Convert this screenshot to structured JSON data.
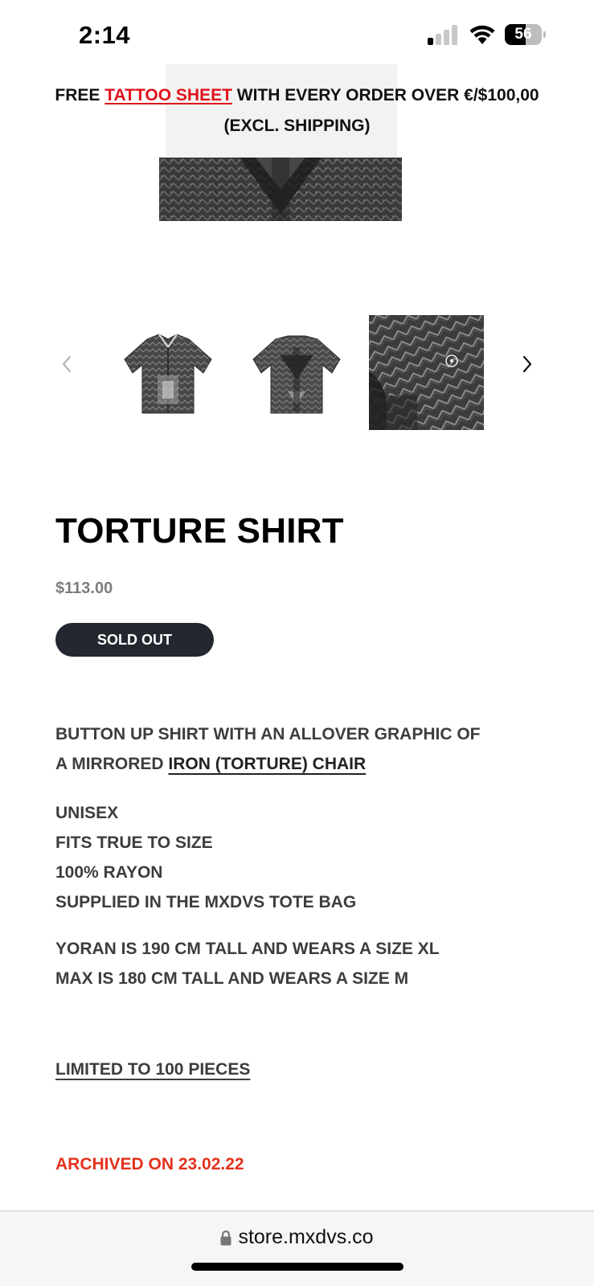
{
  "status_bar": {
    "time": "2:14",
    "battery": "56",
    "signal_bars_active": 1,
    "signal_bars_total": 4
  },
  "announcement": {
    "prefix": "FREE ",
    "link": "TATTOO SHEET",
    "suffix": " WITH EVERY ORDER OVER €/$100,00",
    "line2": "(EXCL. SHIPPING)"
  },
  "gallery": {
    "prev_icon": "chevron-left-icon",
    "next_icon": "chevron-right-icon",
    "thumbnails": [
      "shirt-front",
      "shirt-back",
      "fabric-detail"
    ]
  },
  "product": {
    "title": "TORTURE SHIRT",
    "price": "$113.00",
    "button_label": "SOLD OUT"
  },
  "description": {
    "line1": "BUTTON UP SHIRT WITH AN ALLOVER GRAPHIC OF",
    "line2_prefix": "A MIRRORED ",
    "line2_link": "IRON (TORTURE) CHAIR",
    "details": [
      "UNISEX",
      "FITS TRUE TO SIZE",
      "100% RAYON",
      "SUPPLIED IN THE MXDVS TOTE BAG"
    ],
    "sizing": [
      "YORAN IS 190 CM TALL AND WEARS A SIZE XL",
      "MAX IS 180 CM TALL AND WEARS A SIZE M"
    ],
    "limited": "LIMITED TO 100 PIECES",
    "archived": "ARCHIVED ON 23.02.22"
  },
  "browser": {
    "url": "store.mxdvs.co"
  },
  "colors": {
    "accent_red": "#e1121b",
    "archived_orange": "#e3321c",
    "button_bg": "#23272f",
    "price_gray": "#7d7d7d"
  }
}
